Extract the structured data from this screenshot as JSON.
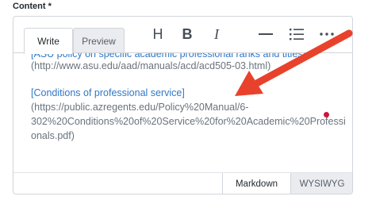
{
  "field": {
    "label": "Content *"
  },
  "tabs": {
    "write": "Write",
    "preview": "Preview"
  },
  "toolbar": {
    "heading": "H",
    "bold": "B",
    "italic": "I",
    "icons": [
      "heading-icon",
      "bold-icon",
      "italic-icon",
      "horizontal-rule-icon",
      "bulleted-list-icon",
      "more-icon"
    ]
  },
  "content": {
    "line1_link": "[ASU policy on specific academic professional ranks and titles]",
    "line2": "(http://www.asu.edu/aad/manuals/acd/acd505-03.html)",
    "line3_link": "[Conditions of professional service]",
    "line4": "(https://public.azregents.edu/Policy%20Manual/6-",
    "line5": "302%20Conditions%20of%20Service%20for%20Academic%20Professi",
    "line6": "onals.pdf)"
  },
  "footer": {
    "markdown": "Markdown",
    "wysiwyg": "WYSIWYG"
  },
  "colors": {
    "arrow": "#e8422c",
    "link": "#3178c6",
    "cursor": "#c9183a"
  }
}
